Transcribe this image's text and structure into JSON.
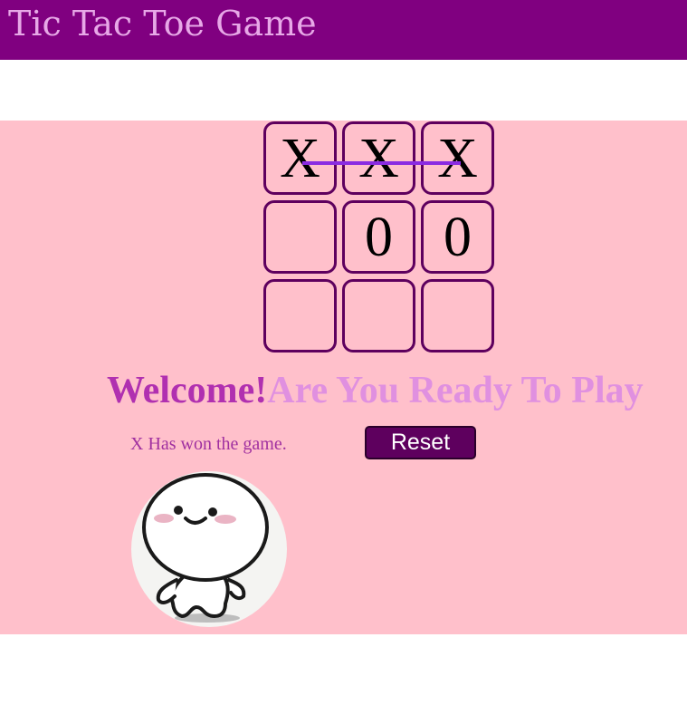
{
  "header": {
    "title": "Tic Tac Toe Game"
  },
  "board": {
    "cells": [
      "X",
      "X",
      "X",
      "",
      "0",
      "0",
      "",
      "",
      ""
    ],
    "winning_row": 0,
    "win_line_color": "#8a2be2"
  },
  "heading": {
    "welcome": "Welcome!",
    "prompt": "Are You Ready To Play"
  },
  "status": {
    "message": "X Has won the game."
  },
  "controls": {
    "reset_label": "Reset"
  },
  "colors": {
    "header_bg": "#800080",
    "header_text": "#e7a8e7",
    "game_bg": "#ffc0cb",
    "cell_border": "#5e005e",
    "button_bg": "#5e005e",
    "welcome_text": "#b030b0",
    "prompt_text": "#e090e0",
    "status_text": "#a030a0"
  },
  "avatar": {
    "icon": "smiling-cartoon-character-icon"
  }
}
